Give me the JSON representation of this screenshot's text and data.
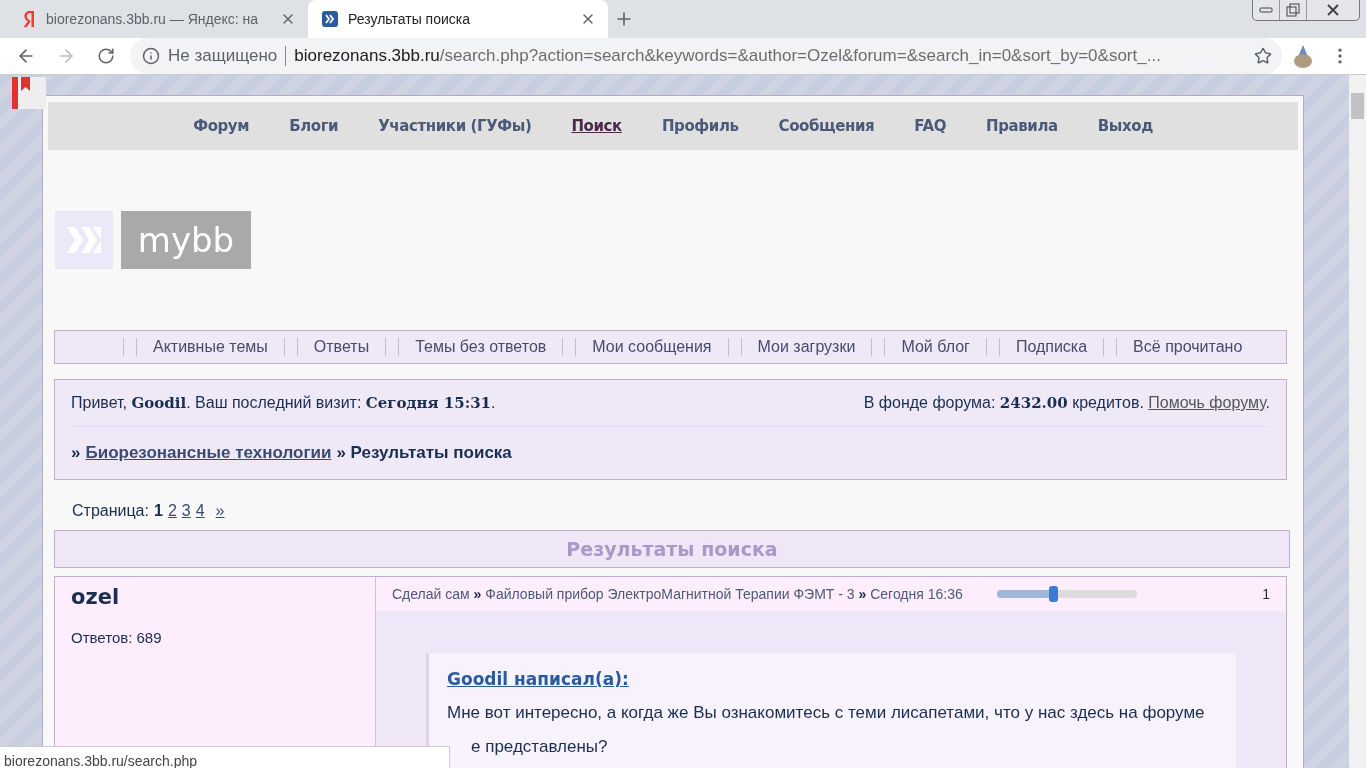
{
  "browser": {
    "tabs": [
      {
        "title": "biorezonans.3bb.ru — Яндекс: на",
        "kind": "yandex",
        "selected": false
      },
      {
        "title": "Результаты поиска",
        "kind": "mybb",
        "selected": true
      }
    ],
    "security": "Не защищено",
    "url_host": "biorezonans.3bb.ru",
    "url_path": "/search.php?action=search&keywords=&author=Ozel&forum=&search_in=0&sort_by=0&sort_...",
    "status": "biorezonans.3bb.ru/search.php"
  },
  "nav": [
    {
      "label": "Форум",
      "selected": false
    },
    {
      "label": "Блоги",
      "selected": false
    },
    {
      "label": "Участники (ГУФы)",
      "selected": false
    },
    {
      "label": "Поиск",
      "selected": true
    },
    {
      "label": "Профиль",
      "selected": false
    },
    {
      "label": "Сообщения",
      "selected": false
    },
    {
      "label": "FAQ",
      "selected": false
    },
    {
      "label": "Правила",
      "selected": false
    },
    {
      "label": "Выход",
      "selected": false
    }
  ],
  "logo": {
    "text": "mybb"
  },
  "submenu": [
    "Активные темы",
    "Ответы",
    "Темы без ответов",
    "Мои сообщения",
    "Мои загрузки",
    "Мой блог",
    "Подписка",
    "Всё прочитано"
  ],
  "welcome": {
    "greeting": "Привет, **Goodil**.  Ваш последний визит: **Сегодня 15:31**.",
    "fund": "В фонде форума: **2432.00** кредитов.",
    "fund_link": "Помочь форуму",
    "fund_tail": "."
  },
  "breadcrumb": {
    "lead": "»",
    "link": "Биорезонансные технологии",
    "tail": "» Результаты поиска"
  },
  "pagination": {
    "label": "Страница:",
    "pages": [
      {
        "label": "1",
        "selected": true
      },
      {
        "label": "2",
        "selected": false
      },
      {
        "label": "3",
        "selected": false
      },
      {
        "label": "4",
        "selected": false
      }
    ],
    "next": "»"
  },
  "results_title": "Результаты поиска",
  "post": {
    "author": "ozel",
    "replies": "Ответов: 689",
    "path": "Сделай сам **»** Файловый прибор ЭлектроМагнитной Терапии ФЭМТ - 3 **»** Сегодня 16:36",
    "level": 0.4,
    "number": "1",
    "quote_title": "Goodil написал(а):",
    "quote_line1": "Мне вот интересно, а когда же Вы ознакомитесь с теми лисапетами, что у нас здесь на форуме",
    "quote_line2": "е представлены?"
  }
}
